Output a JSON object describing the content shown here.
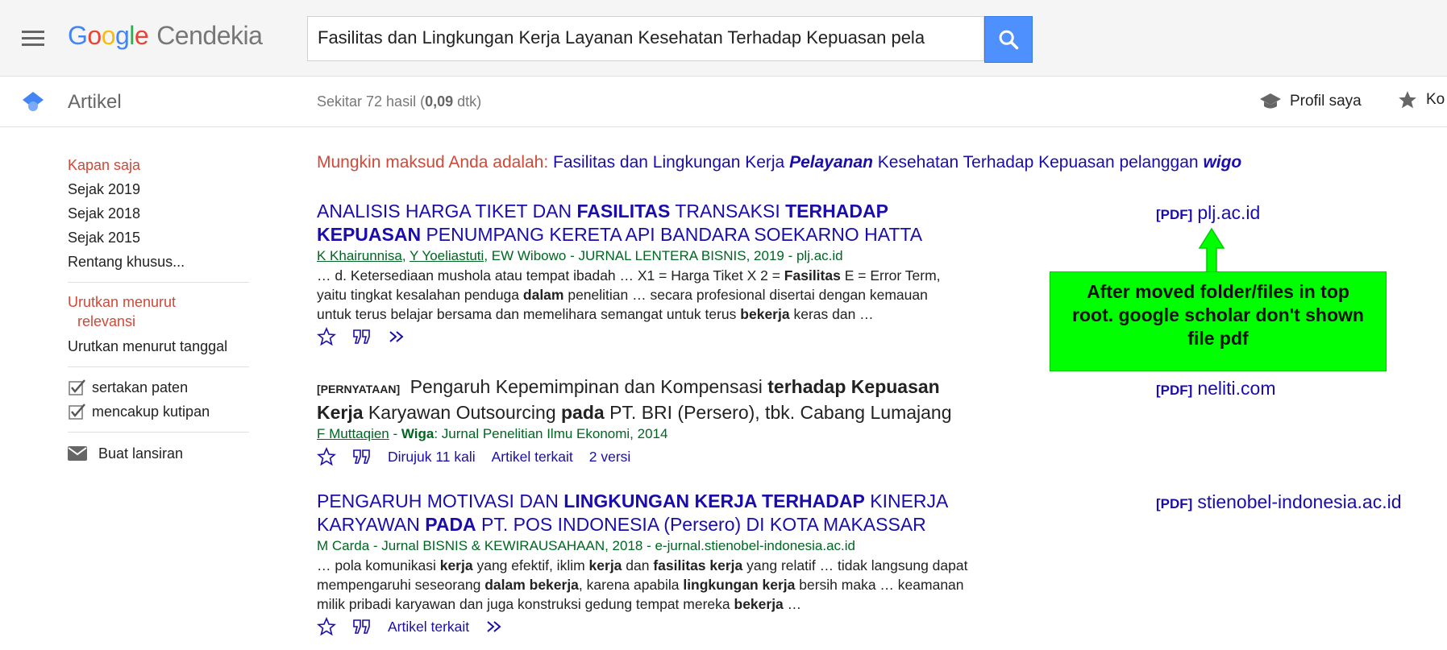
{
  "header": {
    "logo_letters": [
      "G",
      "o",
      "o",
      "g",
      "l",
      "e"
    ],
    "product": "Cendekia",
    "search_value": "Fasilitas dan Lingkungan Kerja Layanan Kesehatan Terhadap Kepuasan pela"
  },
  "subbar": {
    "section": "Artikel",
    "stats_prefix": "Sekitar 72 hasil (",
    "stats_time": "0,09",
    "stats_suffix": " dtk)",
    "profile_label": "Profil saya",
    "library_label": "Ko"
  },
  "sidebar": {
    "time_items": [
      "Kapan saja",
      "Sejak 2019",
      "Sejak 2018",
      "Sejak 2015",
      "Rentang khusus..."
    ],
    "sort_relevance_1": "Urutkan menurut",
    "sort_relevance_2": "relevansi",
    "sort_date": "Urutkan menurut tanggal",
    "include_patents": "sertakan paten",
    "include_citations": "mencakup kutipan",
    "create_alert": "Buat lansiran"
  },
  "did_you_mean": {
    "prefix": "Mungkin maksud Anda adalah:",
    "q1": "Fasilitas dan Lingkungan Kerja ",
    "q2": "Pelayanan",
    "q3": " Kesehatan Terhadap Kepuasan pelanggan ",
    "q4": "wigo"
  },
  "results": [
    {
      "title_parts": [
        "ANALISIS HARGA TIKET DAN ",
        "FASILITAS",
        " TRANSAKSI ",
        "TERHADAP",
        " ",
        "KEPUASAN",
        " PENUMPANG KERETA API BANDARA SOEKARNO HATTA"
      ],
      "authors": [
        "K Khairunnisa",
        "Y Yoeliastuti",
        "EW Wibowo"
      ],
      "source": " - JURNAL LENTERA BISNIS, 2019 - plj.ac.id",
      "snippet_lines": [
        [
          "… d. Ketersediaan mushola atau tempat ibadah … X1 = Harga Tiket X 2 = ",
          "Fasilitas",
          " E = Error Term,"
        ],
        [
          "yaitu tingkat kesalahan penduga ",
          "dalam",
          " penelitian … secara profesional disertai dengan kemauan"
        ],
        [
          "untuk terus belajar bersama dan memelihara semangat untuk terus ",
          "bekerja",
          " keras dan …"
        ]
      ],
      "pdf_tag": "[PDF]",
      "pdf_domain": "plj.ac.id"
    },
    {
      "type_tag": "[PERNYATAAN]",
      "title_parts": [
        " Pengaruh Kepemimpinan dan Kompensasi ",
        "terhadap Kepuasan",
        " ",
        "Kerja",
        " Karyawan Outsourcing ",
        "pada",
        " PT. BRI (Persero), tbk. Cabang Lumajang"
      ],
      "authors": [
        "F Muttaqien"
      ],
      "source_bold": "Wiga",
      "source": ": Jurnal Penelitian Ilmu Ekonomi, 2014",
      "cited_by": "Dirujuk 11 kali",
      "related": "Artikel terkait",
      "versions": "2 versi",
      "pdf_tag": "[PDF]",
      "pdf_domain": "neliti.com"
    },
    {
      "title_parts": [
        "PENGARUH MOTIVASI DAN ",
        "LINGKUNGAN KERJA TERHADAP",
        " KINERJA KARYAWAN ",
        "PADA",
        " PT. POS INDONESIA (Persero) DI KOTA MAKASSAR"
      ],
      "authors_plain": "M Carda",
      "source": " - Jurnal BISNIS & KEWIRAUSAHAAN, 2018 - e-jurnal.stienobel-indonesia.ac.id",
      "snippet_lines": [
        [
          "… pola komunikasi ",
          "kerja",
          " yang efektif, iklim ",
          "kerja",
          " dan ",
          "fasilitas kerja",
          " yang relatif … tidak langsung dapat"
        ],
        [
          "mempengaruhi seseorang ",
          "dalam bekerja",
          ", karena apabila ",
          "lingkungan kerja",
          " bersih maka … keamanan"
        ],
        [
          "milik pribadi karyawan dan juga konstruksi gedung tempat mereka ",
          "bekerja",
          " …"
        ]
      ],
      "related": "Artikel terkait",
      "pdf_tag": "[PDF]",
      "pdf_domain": "stienobel-indonesia.ac.id"
    }
  ],
  "annotation": {
    "line1": "After moved folder/files in top",
    "line2": "root. google scholar don't shown",
    "line3": "file pdf",
    "color": "#00ff00"
  },
  "colors": {
    "link": "#1a0dab",
    "green": "#006621",
    "red": "#d14836",
    "search_button": "#4d90fe"
  }
}
